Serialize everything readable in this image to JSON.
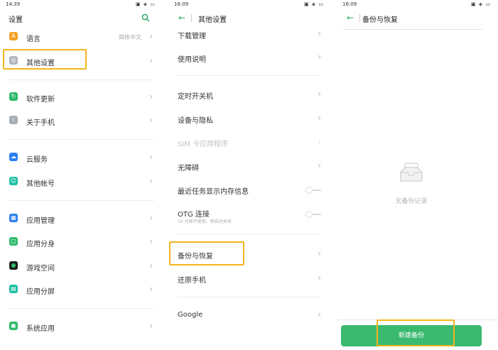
{
  "colors": {
    "accent": "#2daa62",
    "highlight": "#f2b51e"
  },
  "panel1": {
    "status": {
      "time": "14:39",
      "icons": "▣ ◈ ▭"
    },
    "title": "设置",
    "search_icon": "search-icon",
    "items": [
      {
        "label": "语言",
        "value": "简体中文",
        "icon": "language-icon",
        "color": "#f4a123"
      },
      {
        "label": "其他设置",
        "icon": "other-settings-icon",
        "color": "#b0b6bd"
      },
      {
        "label": "软件更新",
        "icon": "update-icon",
        "color": "#2fba6b"
      },
      {
        "label": "关于手机",
        "icon": "info-icon",
        "color": "#a6aeb7"
      },
      {
        "label": "云服务",
        "icon": "cloud-icon",
        "color": "#2b7ff2"
      },
      {
        "label": "其他帐号",
        "icon": "account-icon",
        "color": "#1cbfa3"
      },
      {
        "label": "应用管理",
        "icon": "apps-icon",
        "color": "#2b7ff2"
      },
      {
        "label": "应用分身",
        "icon": "clone-icon",
        "color": "#2fba6b"
      },
      {
        "label": "游戏空间",
        "icon": "game-icon",
        "color": "#1a1a1a"
      },
      {
        "label": "应用分屏",
        "icon": "split-icon",
        "color": "#1cbfa3"
      },
      {
        "label": "系统应用",
        "icon": "system-apps-icon",
        "color": "#2fba6b"
      }
    ]
  },
  "panel2": {
    "status": {
      "time": "16:09",
      "icons": "▣ ◈ ▭"
    },
    "title": "其他设置",
    "items": [
      {
        "label": "下载管理"
      },
      {
        "label": "使用说明"
      },
      {
        "label": "定时开关机"
      },
      {
        "label": "设备与隐私"
      },
      {
        "label": "SIM 卡应用程序"
      },
      {
        "label": "无障碍"
      },
      {
        "label": "最近任务显示内存信息"
      },
      {
        "label": "OTG 连接",
        "sub": "10 分钟不使用，将自动关闭"
      },
      {
        "label": "备份与恢复"
      },
      {
        "label": "还原手机"
      },
      {
        "label": "Google"
      }
    ]
  },
  "panel3": {
    "status": {
      "time": "16:09",
      "icons": "▣ ◈ ▭"
    },
    "title": "备份与恢复",
    "empty_text": "无备份记录",
    "new_backup": "新建备份"
  }
}
